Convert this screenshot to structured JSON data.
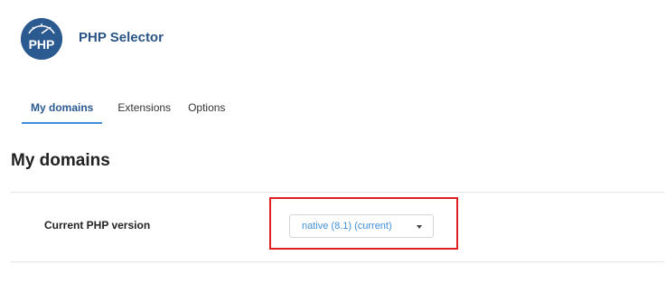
{
  "header": {
    "logo_text": "PHP",
    "title": "PHP Selector"
  },
  "tabs": [
    {
      "label": "My domains",
      "active": true
    },
    {
      "label": "Extensions",
      "active": false
    },
    {
      "label": "Options",
      "active": false
    }
  ],
  "main": {
    "section_title": "My domains",
    "row": {
      "label": "Current PHP version",
      "select_value": "native (8.1) (current)"
    }
  },
  "colors": {
    "brand": "#2b5a91",
    "accent": "#3f8fd8",
    "highlight": "#e02020"
  }
}
